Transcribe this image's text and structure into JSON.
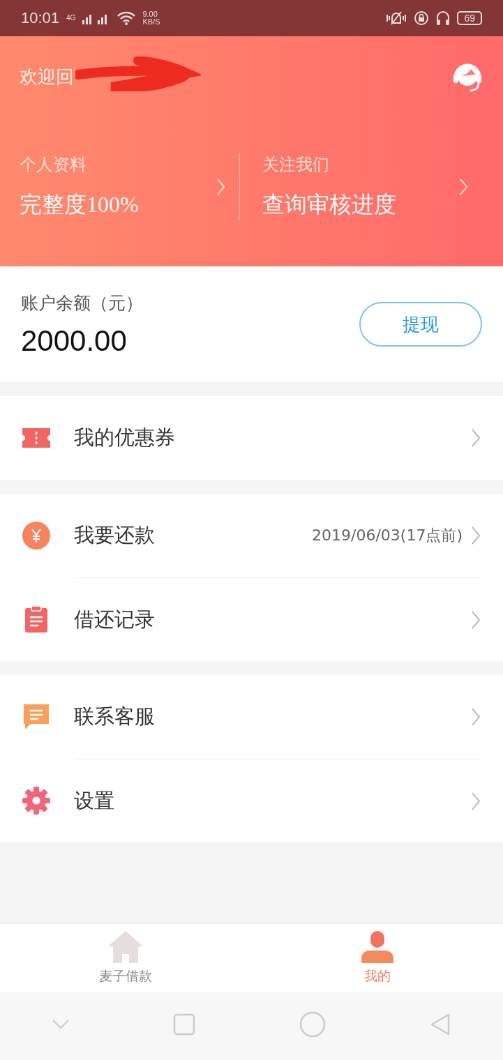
{
  "status_bar": {
    "time": "10:01",
    "network": "4G",
    "speed": "9.00",
    "speed_unit": "KB/S",
    "battery": "69"
  },
  "header": {
    "greeting": "欢迎回",
    "redacted": true,
    "cards": [
      {
        "label": "个人资料",
        "value": "完整度100%"
      },
      {
        "label": "关注我们",
        "value": "查询审核进度"
      }
    ]
  },
  "balance": {
    "label": "账户余额（元）",
    "amount": "2000.00",
    "button": "提现"
  },
  "menu_groups": [
    {
      "items": [
        {
          "kind": "coupon",
          "label": "我的优惠券"
        }
      ]
    },
    {
      "items": [
        {
          "kind": "repay",
          "label": "我要还款",
          "detail": "2019/06/03(17点前)"
        },
        {
          "kind": "record",
          "label": "借还记录"
        }
      ]
    },
    {
      "items": [
        {
          "kind": "chat",
          "label": "联系客服"
        },
        {
          "kind": "settings",
          "label": "设置"
        }
      ]
    }
  ],
  "tab_bar": [
    {
      "kind": "home",
      "label": "麦子借款",
      "selected": false
    },
    {
      "kind": "profile",
      "label": "我的",
      "selected": true
    }
  ]
}
